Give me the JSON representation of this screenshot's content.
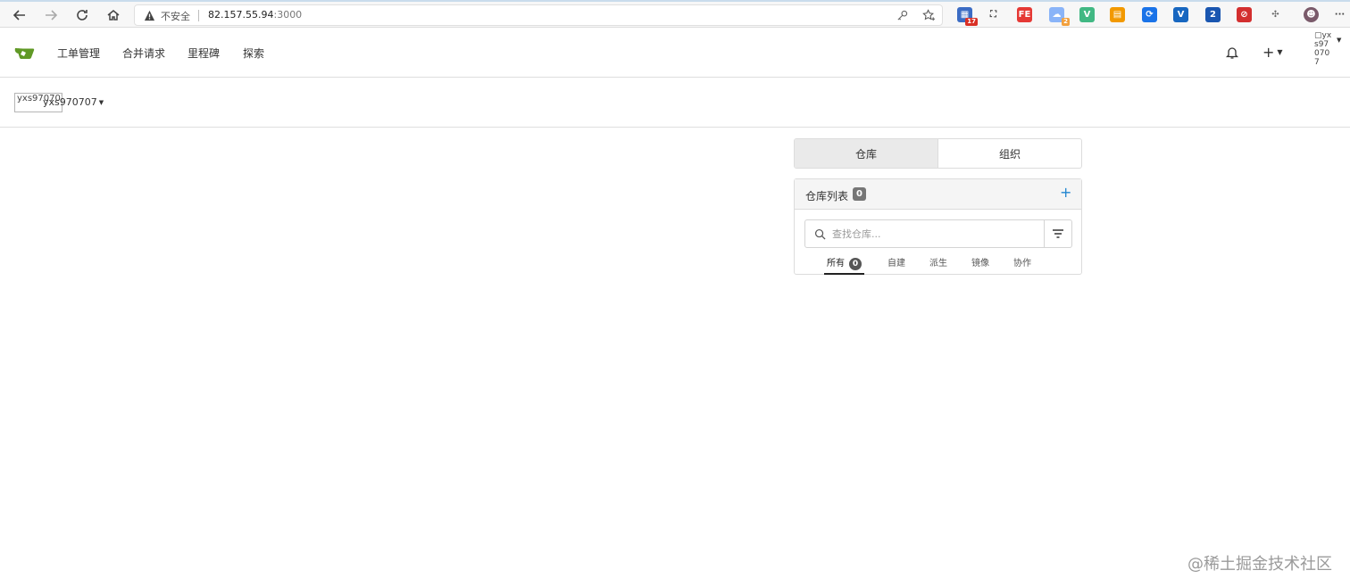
{
  "browser": {
    "insecure_label": "不安全",
    "url_host": "82.157.55.94",
    "url_port": ":3000",
    "extensions": [
      {
        "name": "puzzle-ext-icon",
        "badge": "17",
        "color": "#3b6cc4",
        "badge_color": "#d93025",
        "glyph": "▦"
      },
      {
        "name": "screenshot-ext-icon",
        "badge": "",
        "color": "#444444",
        "badge_color": "",
        "glyph": "⛶"
      },
      {
        "name": "fe-ext-icon",
        "badge": "",
        "color": "#e53935",
        "badge_color": "",
        "glyph": "FE"
      },
      {
        "name": "cloud-ext-icon",
        "badge": "2",
        "color": "#8ab4f8",
        "badge_color": "#f2a03d",
        "glyph": "☁"
      },
      {
        "name": "vue-ext-icon",
        "badge": "",
        "color": "#41b883",
        "badge_color": "",
        "glyph": "V"
      },
      {
        "name": "calculator-ext-icon",
        "badge": "",
        "color": "#f29900",
        "badge_color": "",
        "glyph": "▤"
      },
      {
        "name": "sync-ext-icon",
        "badge": "",
        "color": "#1a73e8",
        "badge_color": "",
        "glyph": "⟳"
      },
      {
        "name": "vuetify-ext-icon",
        "badge": "",
        "color": "#1867c0",
        "badge_color": "",
        "glyph": "V"
      },
      {
        "name": "clipboard-ext-icon",
        "badge": "",
        "color": "#1a56b0",
        "badge_color": "",
        "glyph": "2"
      },
      {
        "name": "block-ext-icon",
        "badge": "",
        "color": "#d32f2f",
        "badge_color": "",
        "glyph": "⊘"
      },
      {
        "name": "extensions-puzzle-icon",
        "badge": "",
        "color": "#666666",
        "badge_color": "",
        "glyph": "✣"
      },
      {
        "name": "profile-avatar-icon",
        "badge": "",
        "color": "#7a5a6a",
        "badge_color": "",
        "glyph": "☻"
      },
      {
        "name": "browser-menu-icon",
        "badge": "",
        "color": "#444444",
        "badge_color": "",
        "glyph": "···"
      }
    ]
  },
  "nav": {
    "items": [
      "工单管理",
      "合并请求",
      "里程碑",
      "探索"
    ],
    "plus_label": "+",
    "user_alt": "yxs970707"
  },
  "context": {
    "avatar_alt": "yxs970707",
    "username": "yxs970707"
  },
  "dashboard": {
    "tabs": [
      "仓库",
      "组织"
    ],
    "repo_list_title": "仓库列表",
    "repo_count": "0",
    "search_placeholder": "查找仓库...",
    "filters": [
      {
        "label": "所有",
        "count": "0"
      },
      {
        "label": "自建"
      },
      {
        "label": "派生"
      },
      {
        "label": "镜像"
      },
      {
        "label": "协作"
      }
    ]
  },
  "watermark": "@稀土掘金技术社区",
  "colors": {
    "accent": "#2185d0",
    "gitea_green": "#609926"
  }
}
